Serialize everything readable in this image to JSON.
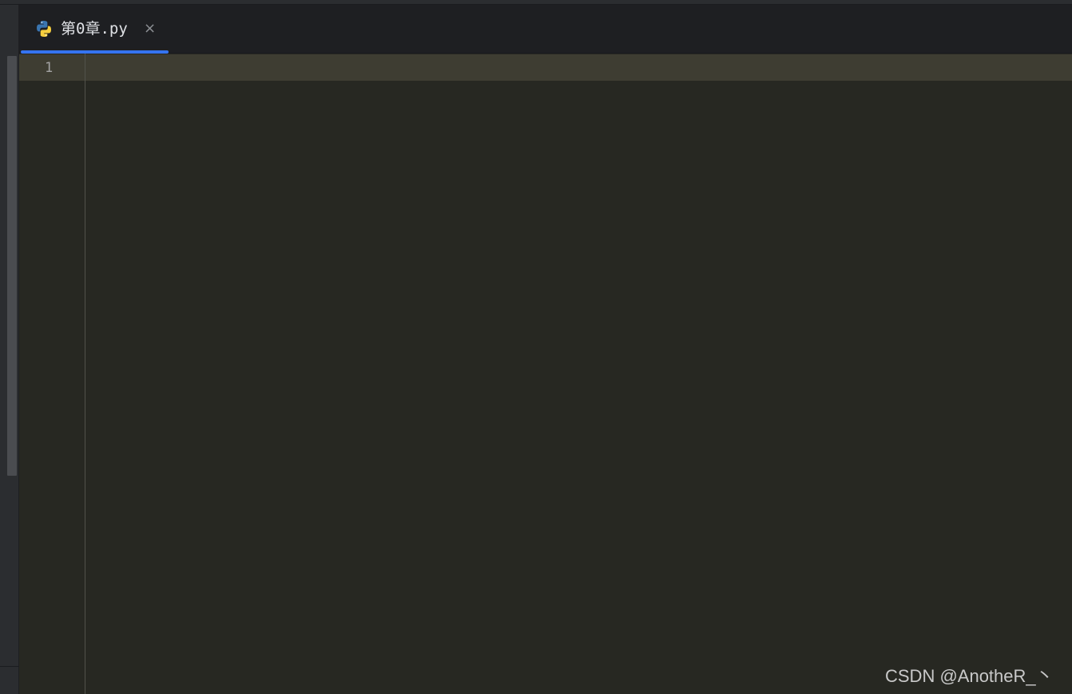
{
  "editor_tabs": [
    {
      "label": "第0章.py",
      "icon": "python-icon",
      "close_symbol": "×",
      "active": true
    }
  ],
  "editor": {
    "line_numbers": [
      "1"
    ],
    "lines": [
      ""
    ]
  },
  "watermark": {
    "text": "CSDN @AnotheR_丶"
  },
  "colors": {
    "editor_background": "#272822",
    "current_line_highlight": "#3e3d32",
    "tab_bar_background": "#1e1f22",
    "active_tab_indicator": "#3574f0",
    "python_blue": "#3a75b0",
    "python_yellow": "#f7cf3e"
  }
}
